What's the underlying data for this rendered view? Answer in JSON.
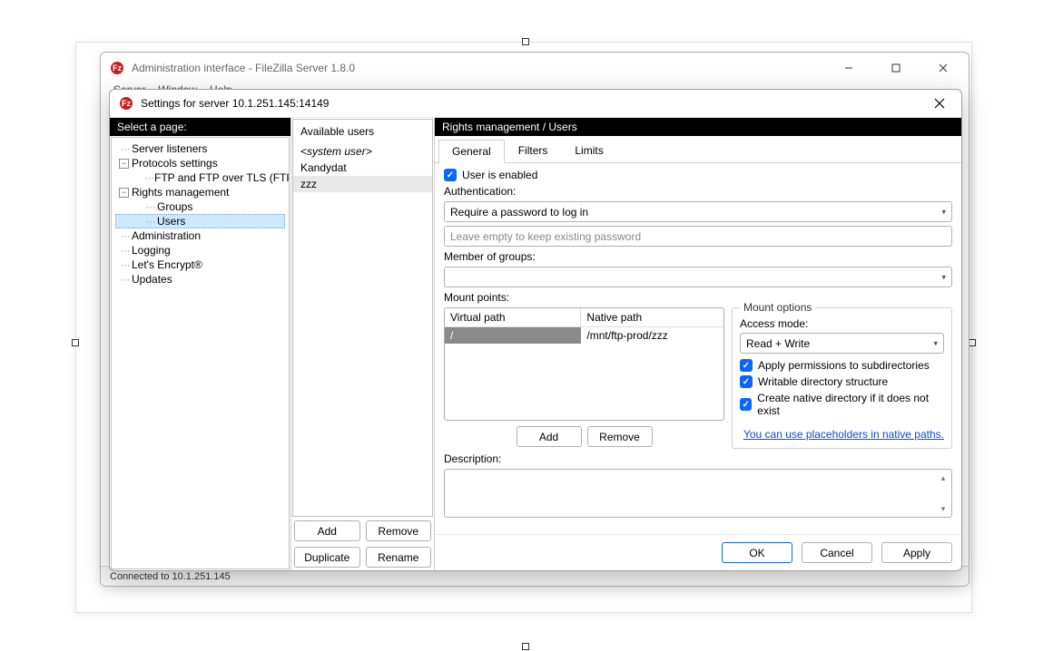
{
  "parent_window": {
    "title": "Administration interface - FileZilla Server 1.8.0",
    "menu": [
      "Server",
      "Window",
      "Help"
    ],
    "status": "Connected to 10.1.251.145"
  },
  "dialog": {
    "title": "Settings for server 10.1.251.145:14149",
    "page_list_header": "Select a page:",
    "right_header": "Rights management / Users",
    "tree": {
      "server_listeners": "Server listeners",
      "protocols": "Protocols settings",
      "ftp_tls": "FTP and FTP over TLS (FTPS)",
      "rights": "Rights management",
      "groups": "Groups",
      "users": "Users",
      "admin": "Administration",
      "logging": "Logging",
      "le": "Let's Encrypt®",
      "updates": "Updates"
    },
    "users_header": "Available users",
    "users": [
      {
        "label": "<system user>",
        "sys": true
      },
      {
        "label": "Kandydat"
      },
      {
        "label": "zzz",
        "selected": true
      }
    ],
    "user_btns": {
      "add": "Add",
      "remove": "Remove",
      "duplicate": "Duplicate",
      "rename": "Rename"
    },
    "tabs": {
      "general": "General",
      "filters": "Filters",
      "limits": "Limits"
    },
    "general": {
      "enabled_label": "User is enabled",
      "auth_label": "Authentication:",
      "auth_value": "Require a password to log in",
      "password_placeholder": "Leave empty to keep existing password",
      "groups_label": "Member of groups:",
      "groups_value": "",
      "mount_label": "Mount points:",
      "col_vpath": "Virtual path",
      "col_npath": "Native path",
      "row_vpath": "/",
      "row_npath": "/mnt/ftp-prod/zzz",
      "add_btn": "Add",
      "remove_btn": "Remove",
      "placeholders_link": "You can use placeholders in native paths.",
      "opts_title": "Mount options",
      "access_label": "Access mode:",
      "access_value": "Read + Write",
      "perm_sub": "Apply permissions to subdirectories",
      "writable_dir": "Writable directory structure",
      "create_native": "Create native directory if it does not exist",
      "desc_label": "Description:"
    },
    "footer": {
      "ok": "OK",
      "cancel": "Cancel",
      "apply": "Apply"
    }
  }
}
